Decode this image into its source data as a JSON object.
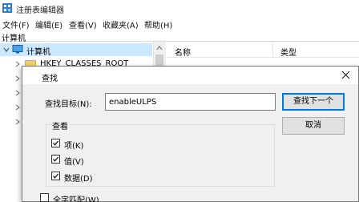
{
  "window": {
    "title": "注册表编辑器"
  },
  "menu": [
    "文件(F)",
    "编辑(E)",
    "查看(V)",
    "收藏夹(A)",
    "帮助(H)"
  ],
  "address": "计算机",
  "tree": {
    "root_label": "计算机",
    "visible_key": "HKEY_CLASSES_ROOT"
  },
  "list": {
    "col_name": "名称",
    "col_type": "类型"
  },
  "dialog": {
    "title": "查找",
    "find_label": "查找目标(N):",
    "find_value": "enableULPS",
    "find_next_button": "查找下一个",
    "cancel_button": "取消",
    "look_at_title": "查看",
    "options": [
      {
        "label": "项(K)",
        "checked": true
      },
      {
        "label": "值(V)",
        "checked": true
      },
      {
        "label": "数据(D)",
        "checked": true
      }
    ],
    "match_whole": {
      "label": "全字匹配(W)",
      "checked": false
    }
  },
  "colors": {
    "accent": "#0078d7",
    "selection": "#cce8ff",
    "folder": "#f3cf6b"
  },
  "icons": [
    "regedit-icon",
    "computer-icon",
    "folder-icon",
    "chevron-right-icon",
    "chevron-down-icon",
    "close-icon",
    "checkmark-icon"
  ]
}
